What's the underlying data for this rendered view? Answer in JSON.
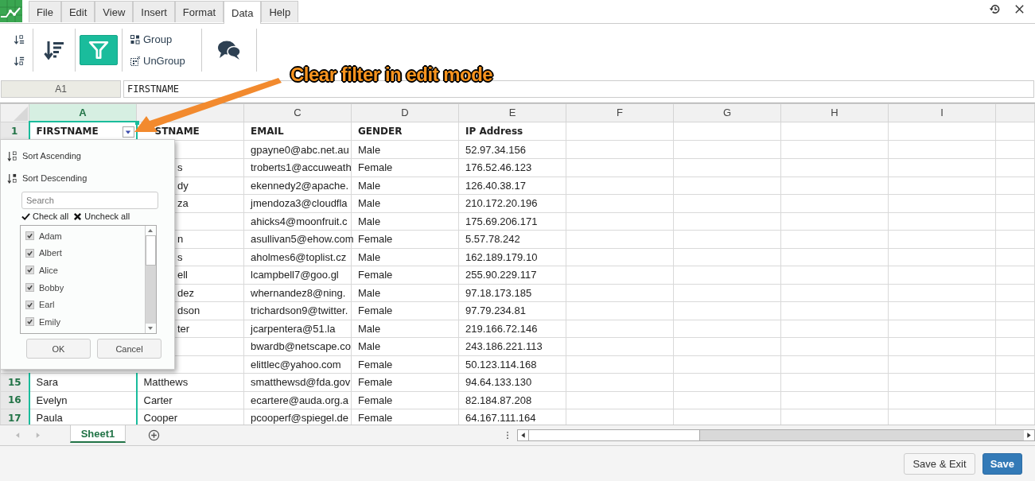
{
  "menu": [
    {
      "label": "File",
      "selected": false
    },
    {
      "label": "Edit",
      "selected": false
    },
    {
      "label": "View",
      "selected": false
    },
    {
      "label": "Insert",
      "selected": false
    },
    {
      "label": "Format",
      "selected": false
    },
    {
      "label": "Data",
      "selected": true
    },
    {
      "label": "Help",
      "selected": false
    }
  ],
  "toolbar": {
    "filter_on": true,
    "group": "Group",
    "ungroup": "UnGroup"
  },
  "name_box": "A1",
  "formula": "FIRSTNAME",
  "annotation": "Clear filter in edit mode",
  "columns": [
    {
      "label": "A",
      "selected": true
    },
    {
      "selected": false
    },
    {
      "label": "C",
      "selected": false
    },
    {
      "label": "D",
      "selected": false
    },
    {
      "label": "E",
      "selected": false
    },
    {
      "label": "F",
      "selected": false
    },
    {
      "label": "G",
      "selected": false
    },
    {
      "label": "H",
      "selected": false
    },
    {
      "label": "I",
      "selected": false
    }
  ],
  "header_row": {
    "number": "1",
    "cells": [
      "FIRSTNAME",
      "STNAME",
      "EMAIL",
      "GENDER",
      "IP Address"
    ]
  },
  "rows": [
    {
      "cells": [
        "gpayne0@abc.net.au",
        "Male",
        "52.97.34.156"
      ]
    },
    {
      "partial": "s",
      "cells": [
        "troberts1@accuweath",
        "Female",
        "176.52.46.123"
      ]
    },
    {
      "partial": "dy",
      "cells": [
        "ekennedy2@apache.",
        "Male",
        "126.40.38.17"
      ]
    },
    {
      "partial": "za",
      "cells": [
        "jmendoza3@cloudfla",
        "Male",
        "210.172.20.196"
      ]
    },
    {
      "cells": [
        "ahicks4@moonfruit.c",
        "Male",
        "175.69.206.171"
      ]
    },
    {
      "partial": "n",
      "cells": [
        "asullivan5@ehow.com",
        "Female",
        "5.57.78.242"
      ]
    },
    {
      "partial": "s",
      "cells": [
        "aholmes6@toplist.cz",
        "Male",
        "162.189.179.10"
      ]
    },
    {
      "partial": "ell",
      "cells": [
        "lcampbell7@goo.gl",
        "Female",
        "255.90.229.117"
      ]
    },
    {
      "partial": "dez",
      "cells": [
        "whernandez8@ning.",
        "Male",
        "97.18.173.185"
      ]
    },
    {
      "partial": "dson",
      "cells": [
        "trichardson9@twitter.",
        "Female",
        "97.79.234.81"
      ]
    },
    {
      "partial": "ter",
      "cells": [
        "jcarpentera@51.la",
        "Male",
        "219.166.72.146"
      ]
    },
    {
      "cells": [
        "bwardb@netscape.co",
        "Male",
        "243.186.221.113"
      ]
    },
    {
      "cells": [
        "elittlec@yahoo.com",
        "Female",
        "50.123.114.168"
      ]
    },
    {
      "number": "15",
      "cells": [
        "Sara",
        "Matthews",
        "smatthewsd@fda.gov",
        "Female",
        "94.64.133.130"
      ]
    },
    {
      "number": "16",
      "cells": [
        "Evelyn",
        "Carter",
        "ecartere@auda.org.a",
        "Female",
        "82.184.87.208"
      ]
    },
    {
      "number": "17",
      "cells": [
        "Paula",
        "Cooper",
        "pcooperf@spiegel.de",
        "Female",
        "64.167.111.164"
      ]
    }
  ],
  "filter_menu": {
    "sort_ascending": "Sort Ascending",
    "sort_descending": "Sort Descending",
    "search_placeholder": "Search",
    "check_all": "Check all",
    "uncheck_all": "Uncheck all",
    "values": [
      {
        "label": "Adam",
        "checked": true
      },
      {
        "label": "Albert",
        "checked": true
      },
      {
        "label": "Alice",
        "checked": true
      },
      {
        "label": "Bobby",
        "checked": true
      },
      {
        "label": "Earl",
        "checked": true
      },
      {
        "label": "Emily",
        "checked": true
      }
    ],
    "ok": "OK",
    "cancel": "Cancel"
  },
  "sheets": [
    {
      "label": "Sheet1",
      "selected": true
    }
  ],
  "buttons": [
    {
      "label": "Save & Exit",
      "kind": "secondary"
    },
    {
      "label": "Save",
      "kind": "primary"
    }
  ]
}
